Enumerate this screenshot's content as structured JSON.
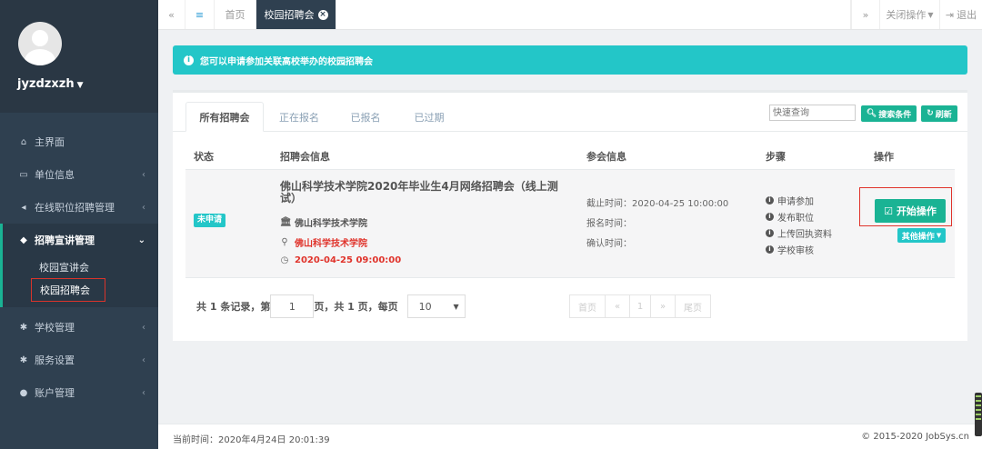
{
  "sidebar": {
    "username": "jyzdzxzh",
    "items": [
      {
        "label": "主界面",
        "icon": "home-icon"
      },
      {
        "label": "单位信息",
        "icon": "desktop-icon"
      },
      {
        "label": "在线职位招聘管理",
        "icon": "bullhorn-icon"
      },
      {
        "label": "招聘宣讲管理",
        "icon": "tag-icon"
      },
      {
        "label": "学校管理",
        "icon": "cogs-icon"
      },
      {
        "label": "服务设置",
        "icon": "cogs-icon"
      },
      {
        "label": "账户管理",
        "icon": "user-icon"
      }
    ],
    "subitems": [
      "校园宣讲会",
      "校园招聘会"
    ]
  },
  "topbar": {
    "home": "首页",
    "active_tab": "校园招聘会",
    "close_ops": "关闭操作",
    "logout": "退出"
  },
  "alert": "您可以申请参加关联高校举办的校园招聘会",
  "tabs": [
    "所有招聘会",
    "正在报名",
    "已报名",
    "已过期"
  ],
  "search": {
    "placeholder": "快速查询",
    "search_btn": "搜索条件",
    "refresh_btn": "刷新"
  },
  "table": {
    "headers": [
      "状态",
      "招聘会信息",
      "参会信息",
      "步骤",
      "操作"
    ],
    "rows": [
      {
        "status": "未申请",
        "title": "佛山科学技术学院2020年毕业生4月网络招聘会（线上测试）",
        "school": "佛山科学技术学院",
        "location": "佛山科学技术学院",
        "time": "2020-04-25 09:00:00",
        "participation": [
          "截止时间：2020-04-25 10:00:00",
          "报名时间：",
          "确认时间："
        ],
        "steps": [
          "申请参加",
          "发布职位",
          "上传回执资料",
          "学校审核"
        ],
        "start_btn": "开始操作",
        "other_btn": "其他操作"
      }
    ]
  },
  "pager": {
    "prefix": "共 1 条记录，第",
    "page": "1",
    "middle": "页，共 1 页，每页",
    "size": "10",
    "first": "首页",
    "prev": "«",
    "current": "1",
    "next": "»",
    "last": "尾页"
  },
  "footer": {
    "time": "当前时间：2020年4月24日 20:01:39",
    "copyright": "© 2015-2020 JobSys.cn"
  },
  "colors": {
    "sidebar": "#2f4050",
    "accent": "#1ab394",
    "info": "#23c6c8",
    "danger": "#e0332b"
  }
}
